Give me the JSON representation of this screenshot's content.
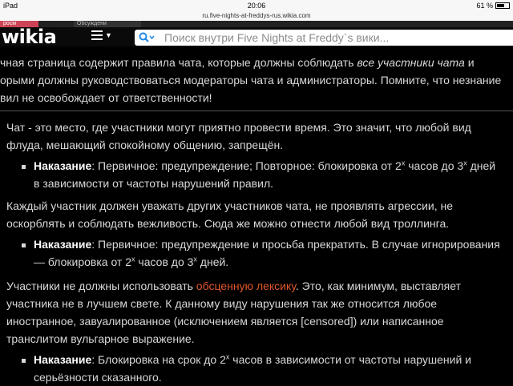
{
  "status_bar": {
    "device": "iPad",
    "time": "20:06",
    "battery": "61 %",
    "battery_level": 0.61
  },
  "browser": {
    "url": "ru.five-nights-at-freddys-rus.wikia.com"
  },
  "tabs": {
    "first": "росм",
    "second": "Обсуждени"
  },
  "header": {
    "logo": "wikia",
    "search_placeholder": "Поиск внутри Five Nights at Freddy`s вики..."
  },
  "intro": {
    "line1_pre": "чная страница содержит правила чата, которые должны соблюдать ",
    "line1_em": "все участники чата",
    "line1_post": " и",
    "line2": "орыми должны руководствоваться модераторы чата и администраторы. Помните, что незнание",
    "line3": "вил не освобождает от ответственности!"
  },
  "rules": [
    {
      "text_lines": [
        "Чат - это место, где участники могут приятно провести время. Это значит, что любой вид",
        "флуда, мешающий спокойному общению, запрещён."
      ],
      "punishment_label": "Наказание",
      "punishment_a": ": Первичное: предупреждение; Повторное: блокировка от 2",
      "exp1": "x",
      "punishment_b": " часов до 3",
      "exp2": "x",
      "punishment_c": " дней",
      "punishment_line2": "в зависимости от частоты нарушений правил."
    },
    {
      "text_lines": [
        "Каждый участник должен уважать других участников чата, не проявлять агрессии, не",
        "оскорблять и соблюдать вежливость. Сюда же можно отнести любой вид троллинга."
      ],
      "punishment_label": "Наказание",
      "punishment_line1": ": Первичное: предупреждение и просьба прекратить. В случае игнорирования",
      "punishment_a": "— блокировка от 2",
      "exp1": "x",
      "punishment_b": " часов до 3",
      "exp2": "x",
      "punishment_c": " дней."
    },
    {
      "text_pre": "Участники не должны использовать ",
      "link": "обсценную лексику",
      "text_post": ". Это, как минимум, выставляет",
      "text_lines": [
        "участника не в лучшем свете. К данному виду нарушения так же относится любое",
        "иностранное, завуалированное (исключением является [censored]) или написанное",
        "транслитом вульгарное выражение."
      ],
      "punishment_label": "Наказание",
      "punishment_a": ": Блокировка на срок до 2",
      "exp1": "x",
      "punishment_b": " часов в зависимости от частоты нарушений и",
      "punishment_line2": "серьёзности сказанного."
    }
  ]
}
